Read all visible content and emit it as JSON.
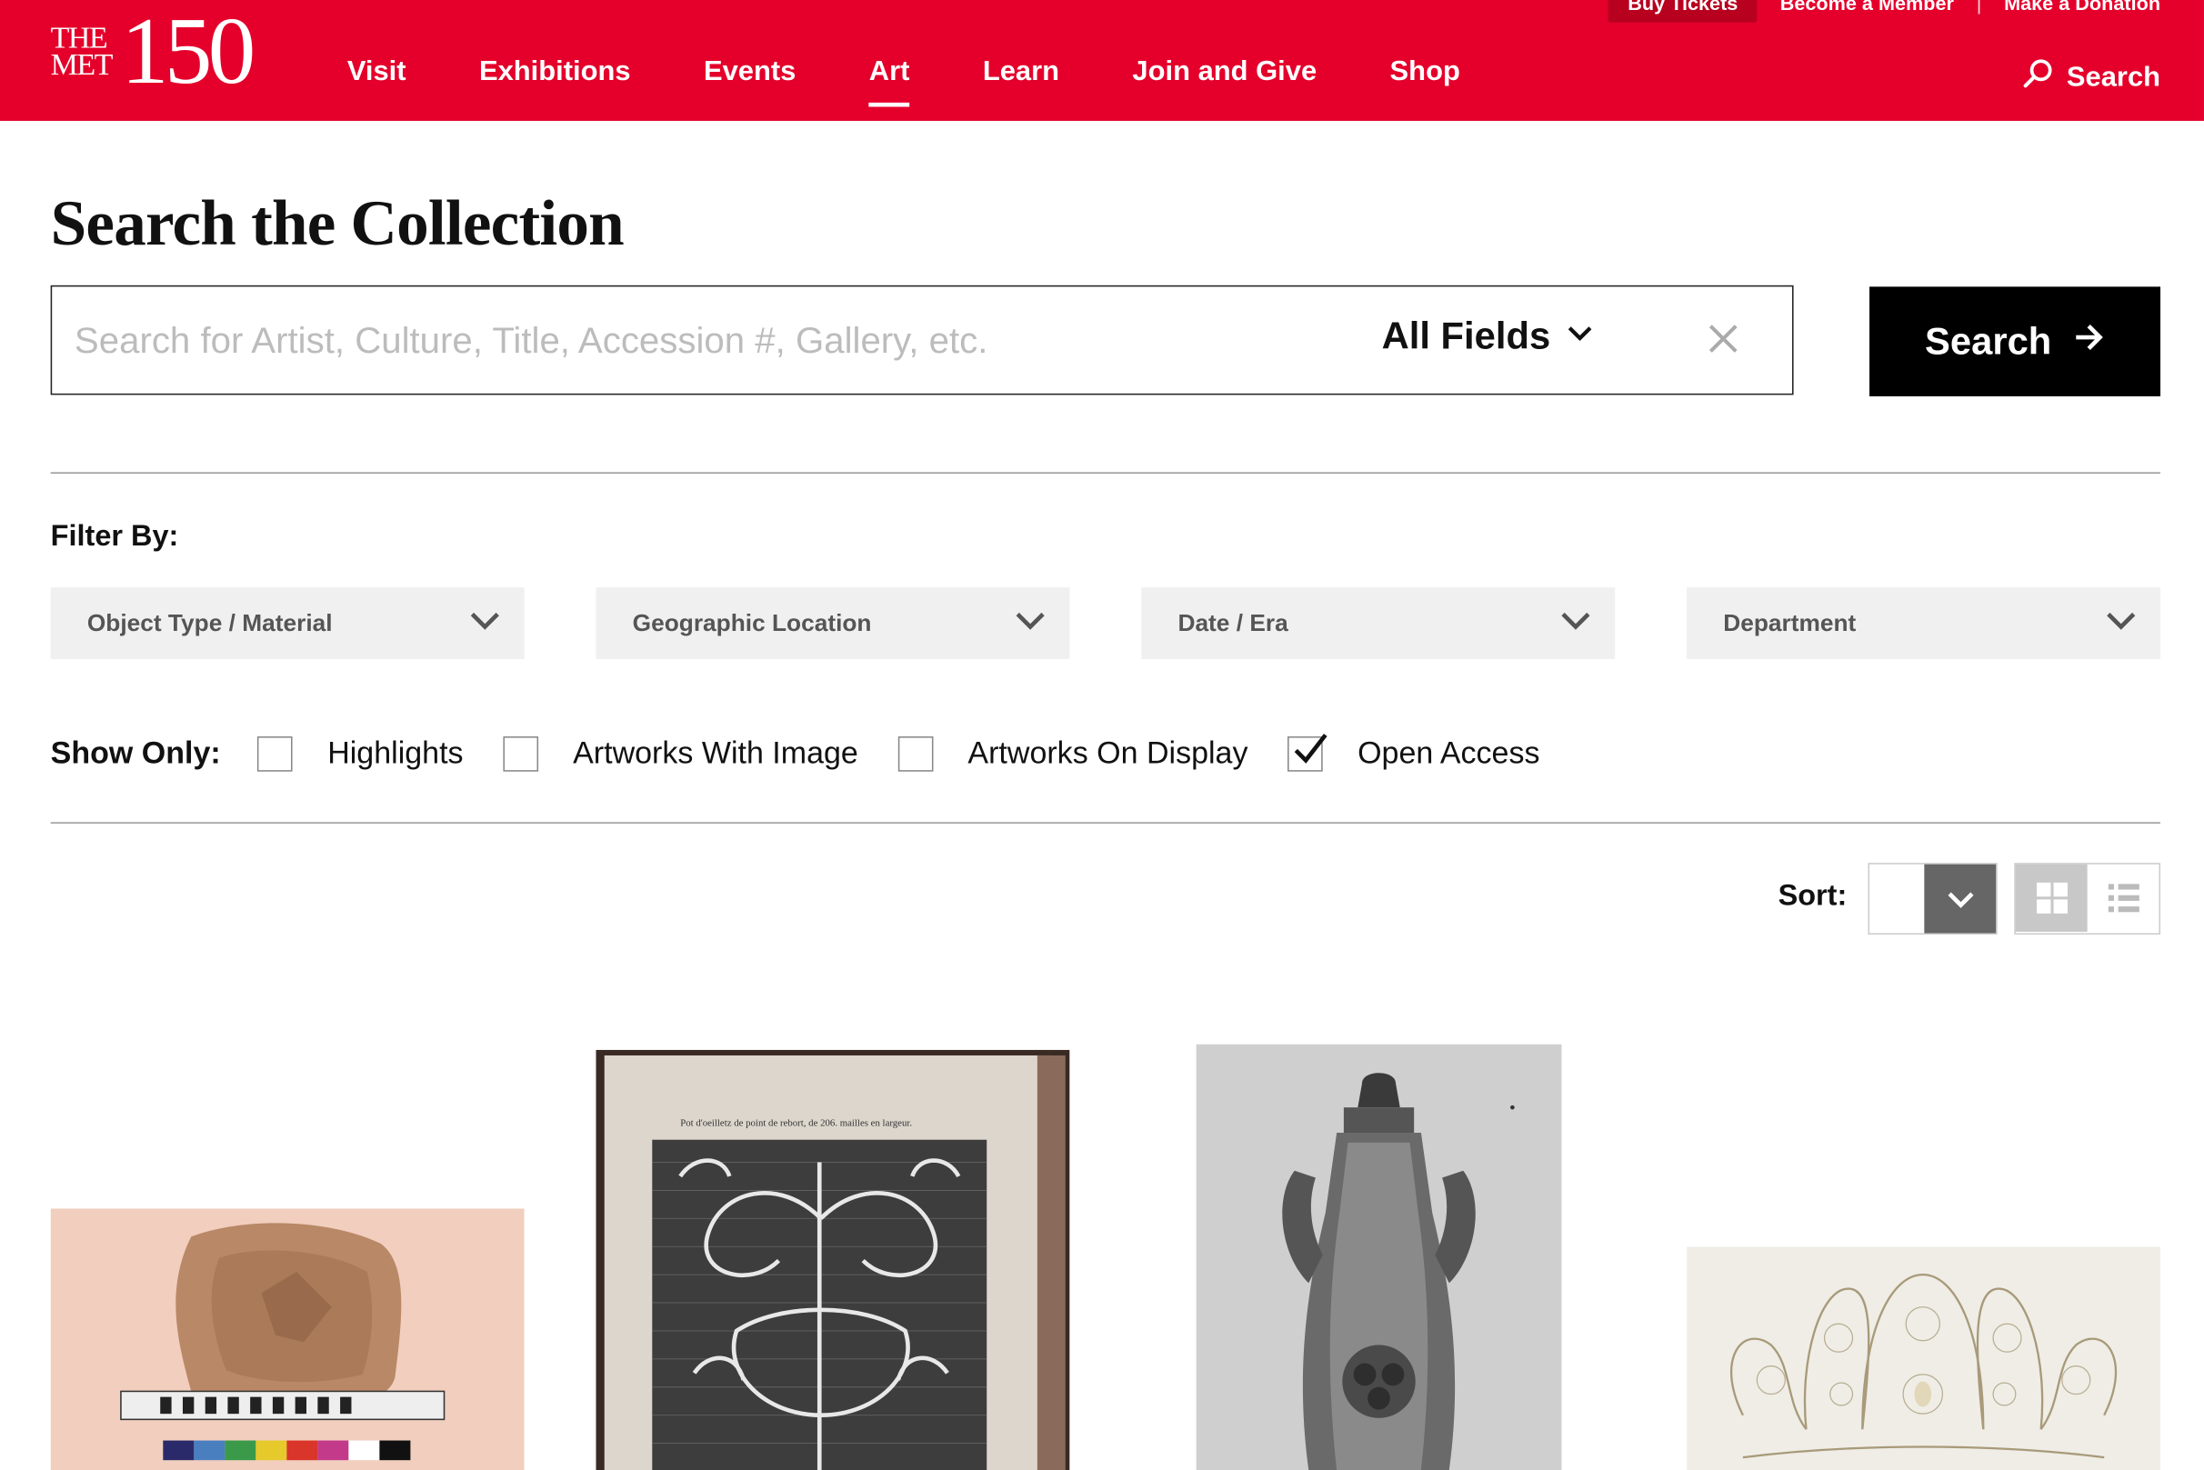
{
  "header": {
    "logo_top": "THE MET",
    "logo_num": "150",
    "utility_links": [
      "Buy Tickets",
      "Become a Member",
      "Make a Donation"
    ],
    "utility_separator": "|",
    "nav": [
      {
        "label": "Visit",
        "active": false
      },
      {
        "label": "Exhibitions",
        "active": false
      },
      {
        "label": "Events",
        "active": false
      },
      {
        "label": "Art",
        "active": true
      },
      {
        "label": "Learn",
        "active": false
      },
      {
        "label": "Join and Give",
        "active": false
      },
      {
        "label": "Shop",
        "active": false
      }
    ],
    "search_label": "Search",
    "brand_color": "#e4002b"
  },
  "page": {
    "title": "Search the Collection"
  },
  "search": {
    "placeholder": "Search for Artist, Culture, Title, Accession #, Gallery, etc.",
    "value": "",
    "field_selector": "All Fields",
    "button_label": "Search"
  },
  "filters": {
    "label": "Filter By:",
    "dropdowns": [
      "Object Type / Material",
      "Geographic Location",
      "Date / Era",
      "Department"
    ]
  },
  "show_only": {
    "label": "Show Only:",
    "options": [
      {
        "label": "Highlights",
        "checked": false
      },
      {
        "label": "Artworks With Image",
        "checked": false
      },
      {
        "label": "Artworks On Display",
        "checked": false
      },
      {
        "label": "Open Access",
        "checked": true
      }
    ]
  },
  "sort": {
    "label": "Sort:",
    "selected": "",
    "view_modes": [
      {
        "name": "grid",
        "active": true
      },
      {
        "name": "list",
        "active": false
      }
    ]
  },
  "results": {
    "items": [
      {
        "image": "stone-relief-fragment",
        "alt": ""
      },
      {
        "image": "lace-pattern-book-page",
        "alt": "",
        "caption": "Pot d'oeilletz de point de rebort, de 206. mailles en largeur."
      },
      {
        "image": "carved-crystal-vase",
        "alt": ""
      },
      {
        "image": "ornamental-crown-drawing",
        "alt": ""
      }
    ]
  }
}
